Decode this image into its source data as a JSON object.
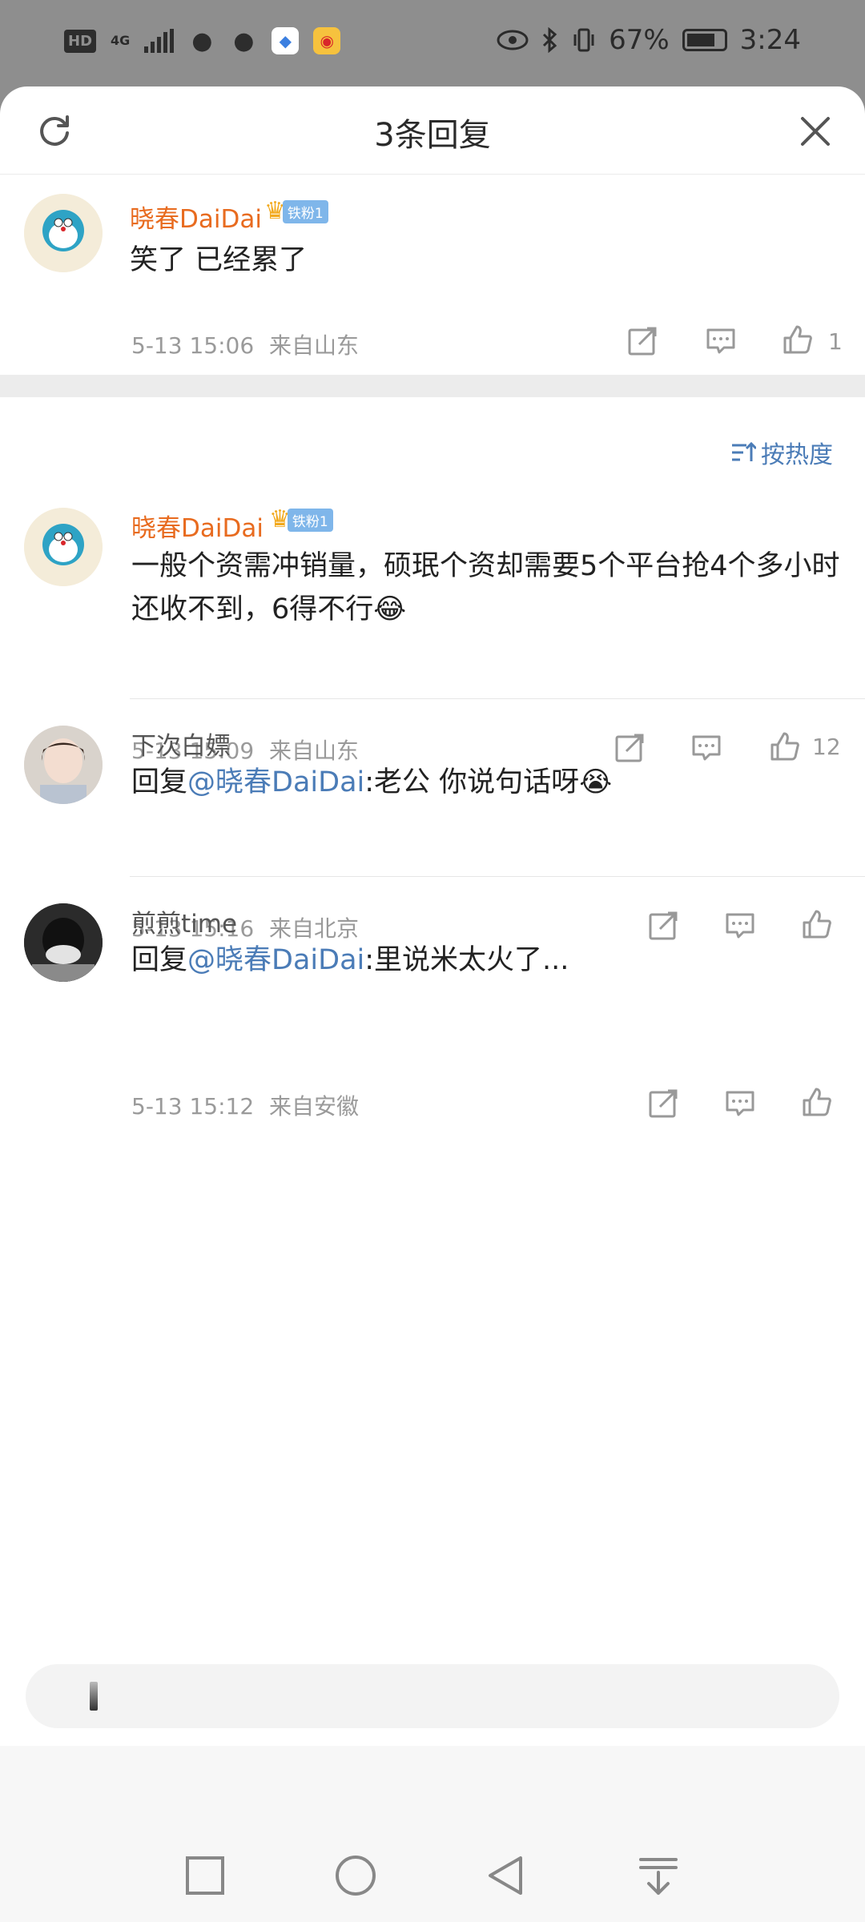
{
  "status_bar": {
    "hd_label": "HD",
    "network_label": "4G",
    "battery_percent": "67%",
    "time": "3:24"
  },
  "sheet": {
    "title": "3条回复"
  },
  "main_comment": {
    "username": "晓春DaiDai",
    "fan_badge": "铁粉1",
    "text": "笑了 已经累了",
    "time": "5-13 15:06",
    "location": "来自山东",
    "like_count": "1"
  },
  "sort_label": "按热度",
  "replies": [
    {
      "username": "晓春DaiDai",
      "fan_badge": "铁粉1",
      "text": "一般个资需冲销量，硕珉个资却需要5个平台抢4个多小时还收不到，6得不行",
      "emoji": "😂",
      "time": "5-13 15:09",
      "location": "来自山东",
      "like_count": "12"
    },
    {
      "username": "下次白嫖",
      "prefix": "回复",
      "mention": "@晓春DaiDai",
      "text": ":老公 你说句话呀",
      "emoji": "😭",
      "time": "5-13 15:16",
      "location": "来自北京",
      "like_count": ""
    },
    {
      "username": "煎煎time",
      "prefix": "回复",
      "mention": "@晓春DaiDai",
      "text": ":里说米太火了...",
      "emoji": "",
      "time": "5-13 15:12",
      "location": "来自安徽",
      "like_count": ""
    }
  ],
  "colors": {
    "accent_blue": "#4b7cb7",
    "username_orange": "#e86b1f",
    "meta_gray": "#9a9a9a"
  }
}
